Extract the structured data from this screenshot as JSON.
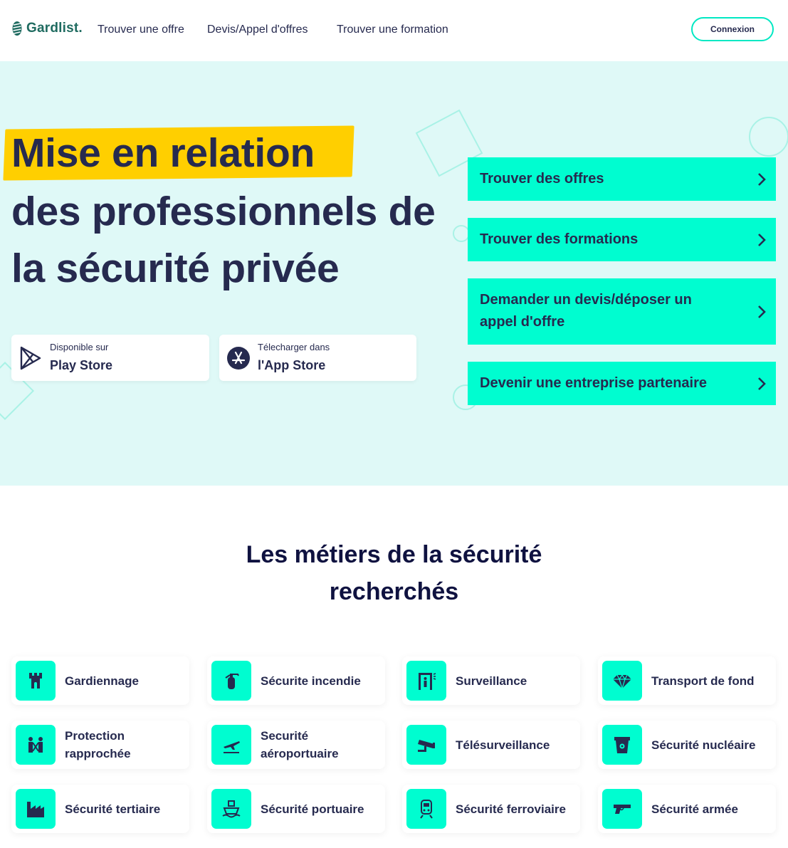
{
  "header": {
    "brand": "Gardlist.",
    "nav": [
      "Trouver une offre",
      "Devis/Appel d'offres",
      "Trouver une formation"
    ],
    "login_label": "Connexion"
  },
  "hero": {
    "line1": "Mise en relation",
    "line2": "des professionnels de",
    "line3": "la sécurité privée",
    "play_store": {
      "small": "Disponible sur",
      "big": "Play Store",
      "icon": "play-store-icon"
    },
    "app_store": {
      "small": "Télecharger dans",
      "big": "l'App Store",
      "icon": "app-store-icon"
    },
    "ctas": [
      {
        "label": "Trouver des offres"
      },
      {
        "label": "Trouver des formations"
      },
      {
        "label": "Demander un devis/déposer un appel d'offre"
      },
      {
        "label": "Devenir une entreprise partenaire"
      }
    ]
  },
  "section": {
    "title_line1": "Les métiers de la sécurité",
    "title_line2": "recherchés"
  },
  "jobs": [
    {
      "label": "Gardiennage",
      "icon": "tower-icon"
    },
    {
      "label": "Sécurite incendie",
      "icon": "fire-extinguisher-icon"
    },
    {
      "label": "Surveillance",
      "icon": "security-gate-icon"
    },
    {
      "label": "Transport de fond",
      "icon": "diamond-icon"
    },
    {
      "label": "Protection rapprochée",
      "icon": "bodyguard-icon"
    },
    {
      "label": "Securité aéroportuaire",
      "icon": "airplane-icon"
    },
    {
      "label": "Télésurveillance",
      "icon": "cctv-camera-icon"
    },
    {
      "label": "Sécurité nucléaire",
      "icon": "nuclear-plant-icon"
    },
    {
      "label": "Sécurité tertiaire",
      "icon": "factory-icon"
    },
    {
      "label": "Sécurité portuaire",
      "icon": "ship-icon"
    },
    {
      "label": "Sécurité ferroviaire",
      "icon": "train-icon"
    },
    {
      "label": "Sécurité armée",
      "icon": "pistol-icon"
    }
  ],
  "colors": {
    "accent": "#00fdd0",
    "hero_bg": "#dff9f7",
    "highlight": "#ffcf00",
    "text_dark": "#262a4f",
    "brand": "#1f6b60"
  }
}
